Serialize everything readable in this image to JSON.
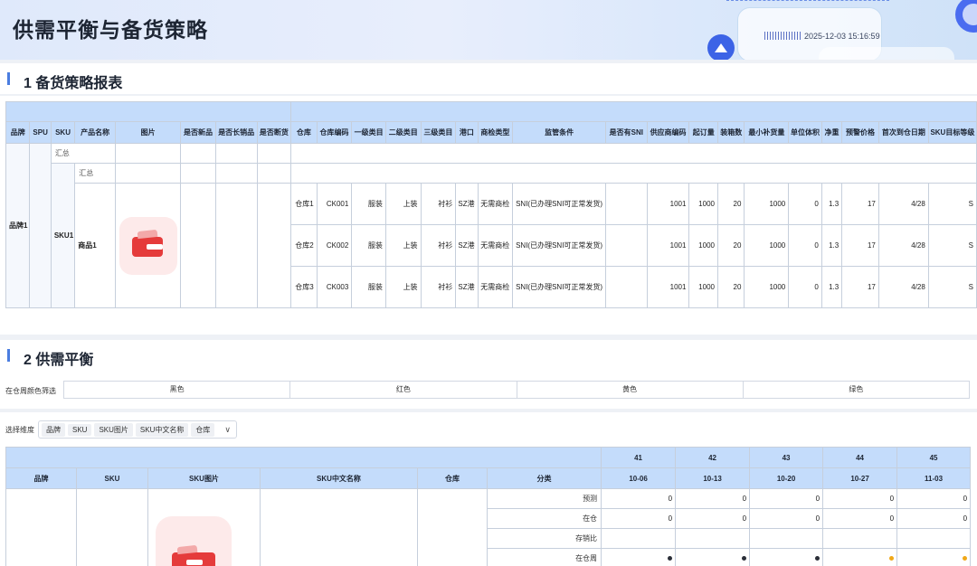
{
  "header": {
    "title": "供需平衡与备货策略",
    "timestamp": "2025-12-03 15:16:59"
  },
  "section1": {
    "title": "1 备货策略报表",
    "columns": [
      "品牌",
      "SPU",
      "SKU",
      "产品名称",
      "图片",
      "是否新品",
      "是否长销品",
      "是否断货",
      "仓库",
      "仓库编码",
      "一级类目",
      "二级类目",
      "三级类目",
      "港口",
      "商检类型",
      "监管条件",
      "是否有SNI",
      "供应商编码",
      "起订量",
      "装箱数",
      "最小补货量",
      "单位体积",
      "净重",
      "预警价格",
      "首次到仓日期",
      "SKU目标等级"
    ],
    "brand": "品牌1",
    "sku": "SKU1",
    "product": "商品1",
    "summary_label": "汇总",
    "image_icon": "wallet-icon",
    "rows": [
      {
        "warehouse": "仓库1",
        "code": "CK001",
        "cat1": "服装",
        "cat2": "上装",
        "cat3": "衬衫",
        "port": "SZ港",
        "inspection": "无需商检",
        "regulation": "SNI(已办理SNI可正常发货)",
        "supplier": "1001",
        "moq": "1000",
        "pack": "20",
        "min_replenish": "1000",
        "volume": "0",
        "weight": "1.3",
        "alert_price": "17",
        "first_date": "4/28",
        "grade": "S"
      },
      {
        "warehouse": "仓库2",
        "code": "CK002",
        "cat1": "服装",
        "cat2": "上装",
        "cat3": "衬衫",
        "port": "SZ港",
        "inspection": "无需商检",
        "regulation": "SNI(已办理SNI可正常发货)",
        "supplier": "1001",
        "moq": "1000",
        "pack": "20",
        "min_replenish": "1000",
        "volume": "0",
        "weight": "1.3",
        "alert_price": "17",
        "first_date": "4/28",
        "grade": "S"
      },
      {
        "warehouse": "仓库3",
        "code": "CK003",
        "cat1": "服装",
        "cat2": "上装",
        "cat3": "衬衫",
        "port": "SZ港",
        "inspection": "无需商检",
        "regulation": "SNI(已办理SNI可正常发货)",
        "supplier": "1001",
        "moq": "1000",
        "pack": "20",
        "min_replenish": "1000",
        "volume": "0",
        "weight": "1.3",
        "alert_price": "17",
        "first_date": "4/28",
        "grade": "S"
      }
    ]
  },
  "section2": {
    "title": "2 供需平衡",
    "color_filter_label": "在仓周颜色筛选",
    "color_tabs": [
      "黑色",
      "红色",
      "黄色",
      "绿色"
    ],
    "dimension_label": "选择维度",
    "dimension_chips": [
      "品牌",
      "SKU",
      "SKU图片",
      "SKU中文名称",
      "仓库"
    ],
    "columns": [
      "品牌",
      "SKU",
      "SKU图片",
      "SKU中文名称",
      "仓库",
      "分类"
    ],
    "weeks": [
      {
        "week": "41",
        "date": "10-06"
      },
      {
        "week": "42",
        "date": "10-13"
      },
      {
        "week": "43",
        "date": "10-20"
      },
      {
        "week": "44",
        "date": "10-27"
      },
      {
        "week": "45",
        "date": "11-03"
      }
    ],
    "rows": [
      {
        "category": "预测",
        "values": [
          "0",
          "0",
          "0",
          "0",
          "0"
        ]
      },
      {
        "category": "在仓",
        "values": [
          "0",
          "0",
          "0",
          "0",
          "0"
        ]
      },
      {
        "category": "存销比",
        "values": [
          "",
          "",
          "",
          "",
          ""
        ]
      },
      {
        "category": "在仓周",
        "dots": [
          "#2b2f38",
          "#2b2f38",
          "#2b2f38",
          "#f0a818",
          "#f0a818"
        ]
      }
    ]
  }
}
